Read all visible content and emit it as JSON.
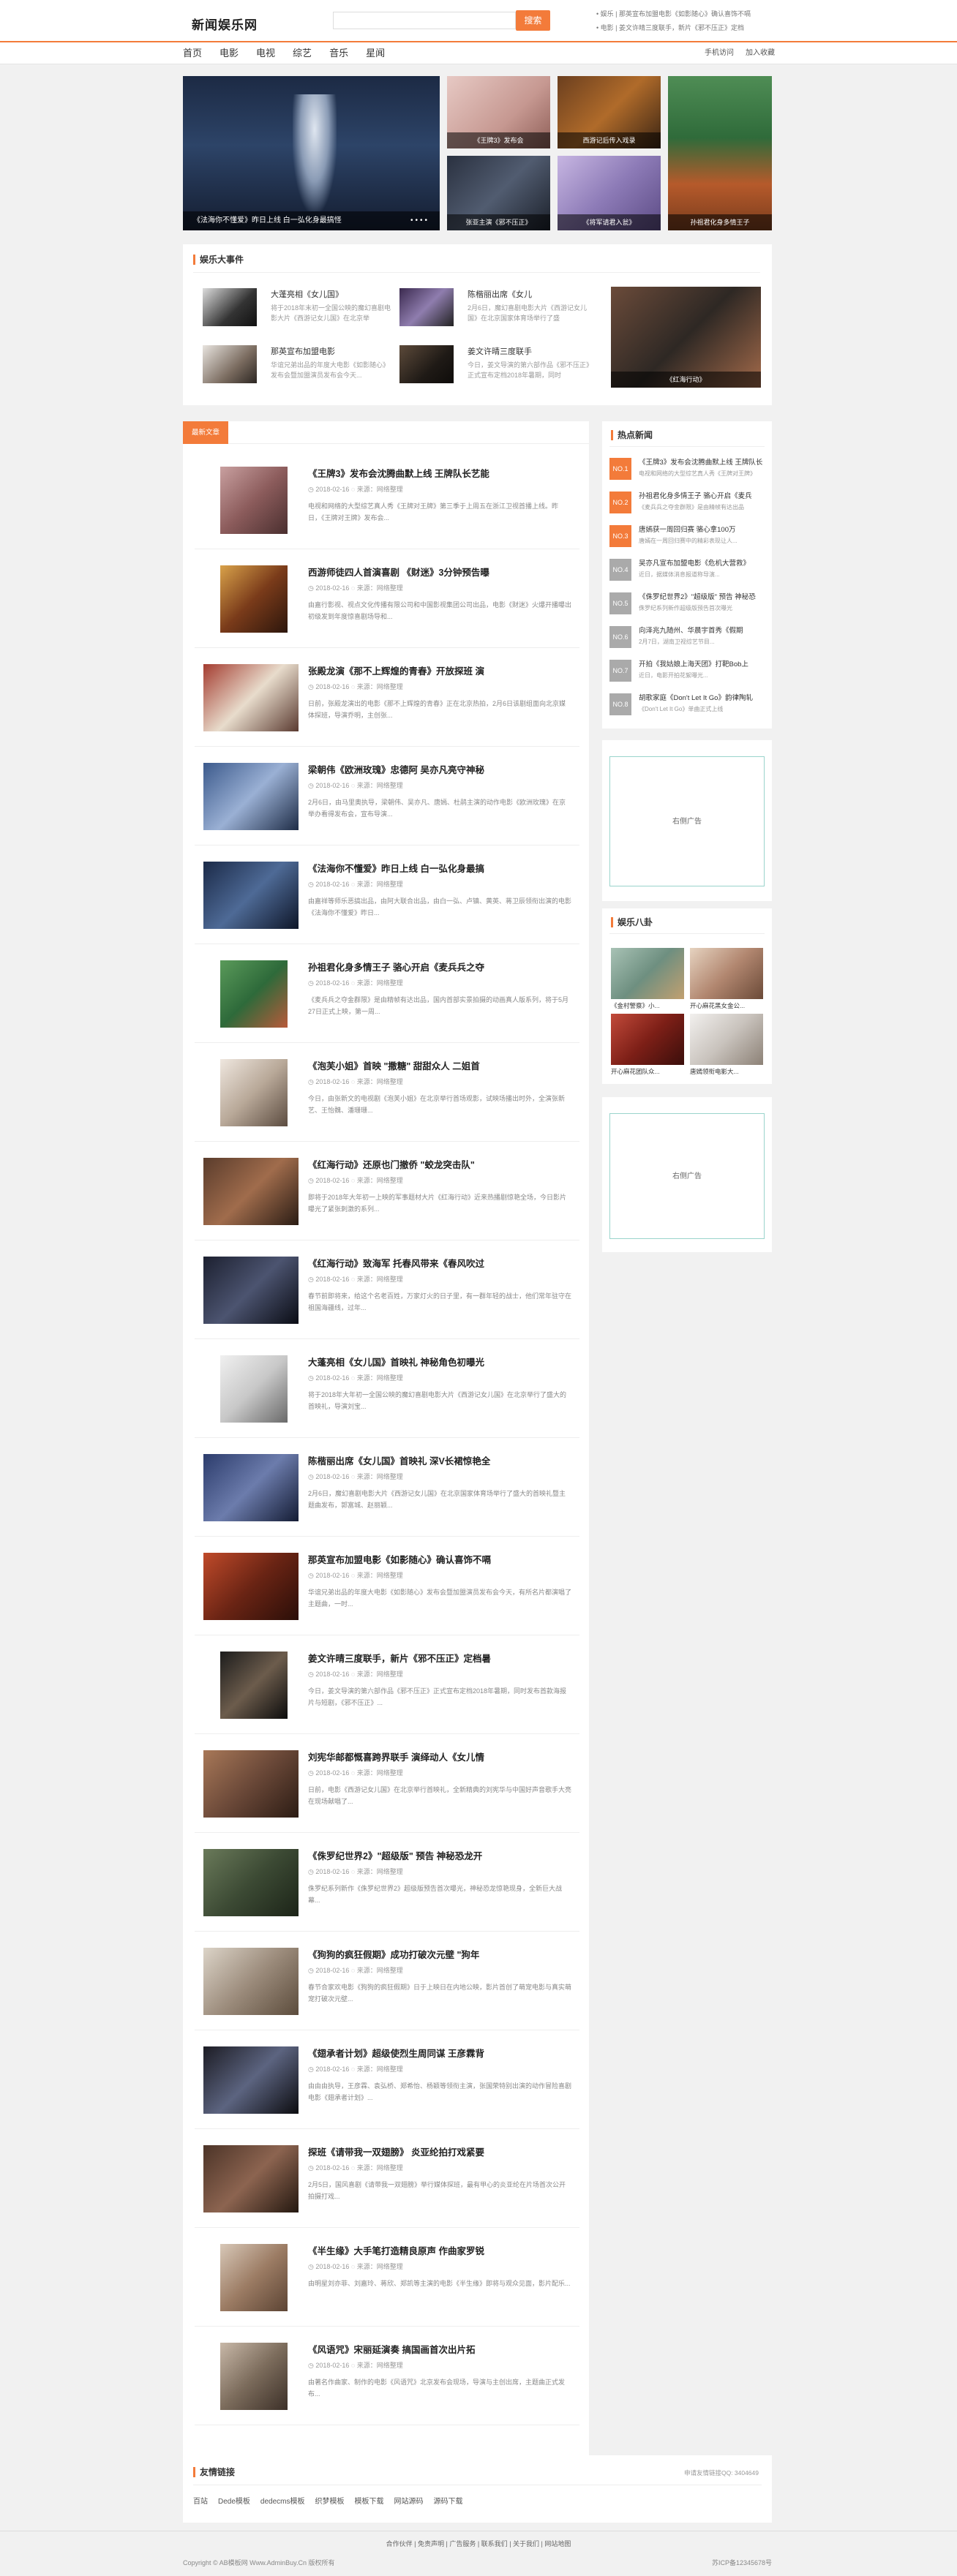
{
  "header": {
    "logo": "新闻娱乐网",
    "search_placeholder": "",
    "search_button": "搜索",
    "top_news": [
      "• 娱乐 | 那英宣布加盟电影《如影随心》确认喜饰不嗝",
      "• 电影 | 姜文许晴三度联手，新片《邪不压正》定档"
    ]
  },
  "nav": {
    "items": [
      "首页",
      "电影",
      "电视",
      "综艺",
      "音乐",
      "星闻"
    ],
    "right": [
      "手机访问",
      "加入收藏"
    ]
  },
  "slider": {
    "main_caption": "《法海你不懂爱》昨日上线 白一弘化身最搞怪",
    "dots": [
      "•",
      "•",
      "•",
      "•"
    ],
    "thumbs": [
      {
        "caption": "《王牌3》发布会"
      },
      {
        "caption": "西游记后传入戏录"
      },
      {
        "caption": "张亚主演《邪不压正》"
      },
      {
        "caption": "《将军请君入瓮》"
      },
      {
        "caption": "孙祖君化身多情王子"
      }
    ]
  },
  "events": {
    "title": "娱乐大事件",
    "items": [
      {
        "title": "大蓬亮相《女儿国》",
        "desc": "将于2018年末初一全国公映的魔幻喜剧电影大片《西游记女儿国》在北京举"
      },
      {
        "title": "陈楷丽出席《女儿",
        "desc": "2月6日，魔幻喜剧电影大片《西游记女儿国》在北京国家体育场举行了盛"
      },
      {
        "title": "那英宣布加盟电影",
        "desc": "华谊兄弟出品的年度大电影《如影随心》发布会暨加盟演员发布会今天..."
      },
      {
        "title": "姜文许晴三度联手",
        "desc": "今日，姜文导演的第六部作品《邪不压正》正式宣布定档2018年暑期，同时"
      }
    ],
    "feature_caption": "《红海行动》"
  },
  "latest": {
    "tab": "最新文章",
    "items": [
      {
        "title": "《王牌3》发布会沈腾曲默上线 王牌队长艺能",
        "date": "2018-02-16",
        "source": "来源：网络整理",
        "desc": "电视和网络的大型综艺真人秀《王牌对王牌》第三季于上周五在浙江卫视首播上线。昨日，《王牌对王牌》发布会..."
      },
      {
        "title": "西游师徒四人首演喜剧 《财迷》3分钟预告曝",
        "date": "2018-02-16",
        "source": "来源：网络整理",
        "desc": "由嘉行影视、视点文化传播有限公司和中国影视集团公司出品，电影《财迷》火爆开播曝出初级发到年度惊喜剧场导和..."
      },
      {
        "title": "张殿龙演《那不上辉煌的青春》开放探班 演",
        "date": "2018-02-16",
        "source": "来源：网络整理",
        "desc": "日前，张殿龙演出的电影《那不上辉煌的青春》正在北京热拍，2月6日该剧组面向北京媒体探班，导演乔明，主创张..."
      },
      {
        "title": "梁朝伟《欧洲玫瑰》忠德阿 吴亦凡亮守神秘",
        "date": "2018-02-16",
        "source": "来源：网络整理",
        "desc": "2月6日，由马里奥执导，梁朝伟、吴亦凡、唐嫣、杜鹃主演的动作电影《欧洲玫瑰》在京举办看得发布会，宣布导演..."
      },
      {
        "title": "《法海你不懂爱》昨日上线 白一弘化身最搞",
        "date": "2018-02-16",
        "source": "来源：网络整理",
        "desc": "由嘉祥等师乐恶搞出品，由阿大联合出品，由白一弘、卢镇、黄英、蒋卫辰领衔出演的电影《法海你不懂爱》昨日..."
      },
      {
        "title": "孙祖君化身多情王子 骆心开启《麦兵兵之夺",
        "date": "2018-02-16",
        "source": "来源：网络整理",
        "desc": "《麦兵兵之夺金群限》是由精帧有达出品，国内首部实景拍摄的动画真人版系列，将于5月27日正式上映，第一周..."
      },
      {
        "title": "《泡芙小姐》首映 \"撒糖\" 甜甜众人 二姐首",
        "date": "2018-02-16",
        "source": "来源：网络整理",
        "desc": "今日，由张新文的电视剧《泡芙小姐》在北京举行首场观影，试映场播出时外，全演张新艺、王怡魏、潘珊珊..."
      },
      {
        "title": "《红海行动》还原也门撤侨 \"蛟龙突击队\"",
        "date": "2018-02-16",
        "source": "来源：网络整理",
        "desc": "即将于2018年大年初一上映的军事题材大片《红海行动》近来热播剧惊艳全场，今日影片曝光了紧张刺激的系列..."
      },
      {
        "title": "《红海行动》致海军 托春风带来《春风吹过",
        "date": "2018-02-16",
        "source": "来源：网络整理",
        "desc": "春节前即将来，给这个名老百姓，万家灯火的日子里，有一群年轻的战士，他们常年驻守在祖国海疆线，过年..."
      },
      {
        "title": "大蓬亮相《女儿国》首映礼 神秘角色初曝光",
        "date": "2018-02-16",
        "source": "来源：网络整理",
        "desc": "将于2018年大年初一全国公映的魔幻喜剧电影大片《西游记女儿国》在北京举行了盛大的首映礼，导演刘宝..."
      },
      {
        "title": "陈楷丽出席《女儿国》首映礼 深V长裙惊艳全",
        "date": "2018-02-16",
        "source": "来源：网络整理",
        "desc": "2月6日，魔幻喜剧电影大片《西游记女儿国》在北京国家体育场举行了盛大的首映礼暨主题曲发布，郭富城、赵丽颖..."
      },
      {
        "title": "那英宣布加盟电影《如影随心》确认喜饰不嗝",
        "date": "2018-02-16",
        "source": "来源：网络整理",
        "desc": "华谊兄弟出品的年度大电影《如影随心》发布会暨加盟演员发布会今天，有所名片都演唱了主题曲，一时..."
      },
      {
        "title": "姜文许晴三度联手，新片《邪不压正》定档暑",
        "date": "2018-02-16",
        "source": "来源：网络整理",
        "desc": "今日，姜文导演的第六部作品《邪不压正》正式宣布定档2018年暑期，同时发布首款海报片与短剧，《邪不压正》..."
      },
      {
        "title": "刘宪华邮都慨喜跨界联手 演绎动人《女儿情",
        "date": "2018-02-16",
        "source": "来源：网络整理",
        "desc": "日前，电影《西游记女儿国》在北京举行首映礼，全新精典的刘宪华与中国好声音歌手大亮在现场献唱了..."
      },
      {
        "title": "《侏罗纪世界2》\"超级版\" 预告 神秘恐龙开",
        "date": "2018-02-16",
        "source": "来源：网络整理",
        "desc": "侏罗纪系列新作《侏罗纪世界2》超级版预告首次曝光，神秘恐龙惊艳现身，全新巨大战幕..."
      },
      {
        "title": "《狗狗的疯狂假期》成功打破次元壁 \"狗年",
        "date": "2018-02-16",
        "source": "来源：网络整理",
        "desc": "春节合家欢电影《狗狗的疯狂假期》日于上映日在内地公映，影片首创了萌宠电影与真实萌宠打破次元壁..."
      },
      {
        "title": "《翅承者计划》超级使烈生周同谋 王彦霖背",
        "date": "2018-02-16",
        "source": "来源：网络整理",
        "desc": "由由由执导，王彦霖、袁弘桥、郑希怡、杨颖等领衔主演，张国荣特别出演的动作冒险喜剧电影《翅承者计划》..."
      },
      {
        "title": "探班《请带我一双翅膀》 炎亚纶拍打戏紧要",
        "date": "2018-02-16",
        "source": "来源：网络整理",
        "desc": "2月5日，国风喜剧《请带我一双翅膀》举行媒体探班，最有甲心的炎亚纶在片场首次公开拍摄打戏..."
      },
      {
        "title": "《半生缘》大手笔打造精良原声 作曲家罗锐",
        "date": "2018-02-16",
        "source": "来源：网络整理",
        "desc": "由明星刘亦菲、刘嘉玲、蒋欣、郑凯等主演的电影《半生缘》即将与观众见面，影片配乐..."
      },
      {
        "title": "《风语咒》宋丽延演奏 搞国画首次出片拓",
        "date": "2018-02-16",
        "source": "来源：网络整理",
        "desc": "由著名作曲家、制作的电影《风语咒》北京发布会现场，导演与主创出席，主题曲正式发布..."
      }
    ]
  },
  "hot": {
    "title": "热点新闻",
    "items": [
      {
        "num": "NO.1",
        "title": "《王牌3》发布会沈腾曲默上线 王牌队长",
        "sub": "电视和网络的大型综艺真人秀《王牌对王牌》"
      },
      {
        "num": "NO.2",
        "title": "孙祖君化身多情王子 骆心开启《麦兵",
        "sub": "《麦兵兵之夺金群限》是由精帧有达出品"
      },
      {
        "num": "NO.3",
        "title": "唐嫣获一周回归赛 骆心拿100万",
        "sub": "唐嫣在一周回归赛中的精彩表现让人..."
      },
      {
        "num": "NO.4",
        "title": "吴亦凡宣布加盟电影《危机大营救》",
        "sub": "近日，据媒体消息报道称导演..."
      },
      {
        "num": "NO.5",
        "title": "《侏罗纪世界2》\"超级版\" 预告 神秘恐",
        "sub": "侏罗纪系列新作超级版预告首次曝光"
      },
      {
        "num": "NO.6",
        "title": "向泽兆九随州、华晨宇首秀《假期",
        "sub": "2月7日，湖南卫视综艺节目..."
      },
      {
        "num": "NO.7",
        "title": "开拍《我姑娘上海天团》打靶Bob上",
        "sub": "近日，电影开拍花絮曝光..."
      },
      {
        "num": "NO.8",
        "title": "胡歌家庭《Don't Let It Go》韵律陶轧",
        "sub": "《Don't Let It Go》单曲正式上线"
      }
    ]
  },
  "ads": {
    "label": "右侧广告"
  },
  "gossip": {
    "title": "娱乐八卦",
    "items": [
      {
        "title": "《金村警察》小..."
      },
      {
        "title": "开心麻花黑女金公..."
      },
      {
        "title": "开心麻花团队众..."
      },
      {
        "title": "唐嫣领衔电影大..."
      }
    ]
  },
  "links": {
    "title": "友情链接",
    "right": "申请友情链接QQ: 3404649",
    "items": [
      "百站",
      "Dede模板",
      "dedecms模板",
      "织梦模板",
      "模板下载",
      "网站源码",
      "源码下载"
    ]
  },
  "footer": {
    "links": [
      "合作伙伴",
      "免责声明",
      "广告服务",
      "联系我们",
      "关于我们",
      "网站地图"
    ],
    "copyright": "Copyright © AB模板网 Www.AdminBuy.Cn 版权所有",
    "icp": "苏ICP备12345678号"
  },
  "colors": {
    "accent": "#f37b3a",
    "hot_top": "#f37b3a",
    "hot_rest": "#aaaaaa"
  }
}
